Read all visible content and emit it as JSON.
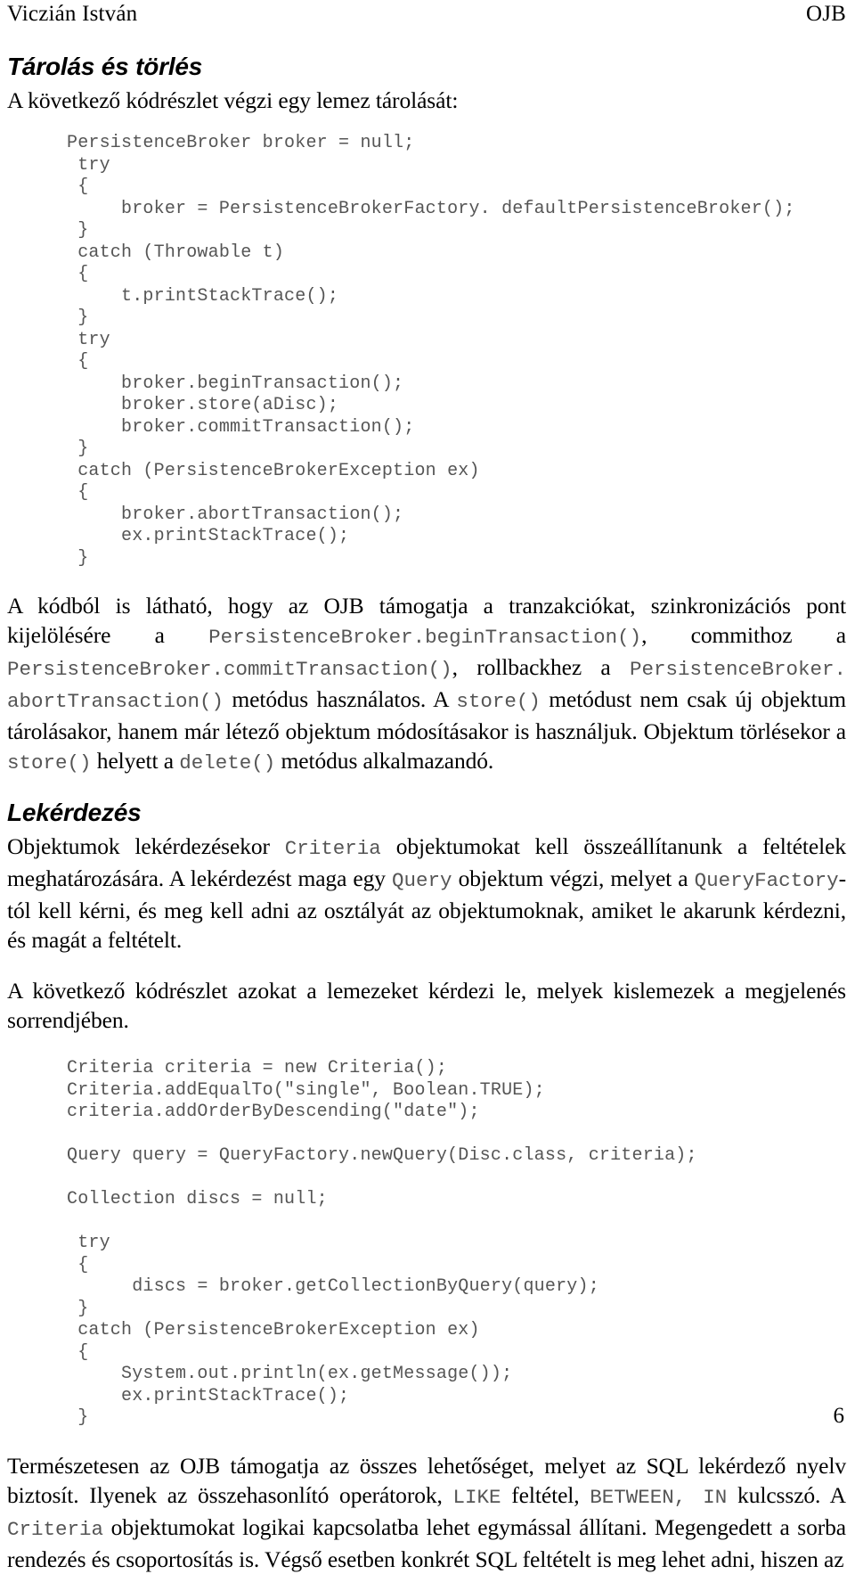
{
  "header": {
    "author": "Viczián István",
    "doc_title": "OJB"
  },
  "footer": {
    "page_number": "6"
  },
  "sections": [
    {
      "heading": "Tárolás és törlés",
      "intro": "A következő kódrészlet végzi egy lemez tárolását:",
      "code": "PersistenceBroker broker = null;\n try\n {\n     broker = PersistenceBrokerFactory. defaultPersistenceBroker();\n }\n catch (Throwable t)\n {\n     t.printStackTrace();\n }\n try\n {\n     broker.beginTransaction();\n     broker.store(aDisc);\n     broker.commitTransaction();\n }\n catch (PersistenceBrokerException ex)\n {\n     broker.abortTransaction();\n     ex.printStackTrace();\n }"
    },
    {
      "heading": "Lekérdezés"
    }
  ],
  "paragraphs": {
    "transactions": {
      "part1": "A kódból is látható, hogy az OJB támogatja a tranzakciókat, szinkronizációs pont kijelölésére a ",
      "code1": "PersistenceBroker.beginTransaction()",
      "part2": ", commithoz a ",
      "code2": "PersistenceBroker.commitTransaction()",
      "part3": ", rollbackhez a ",
      "code3": "PersistenceBroker. abortTransaction()",
      "part4": " metódus használatos. A ",
      "code4": "store()",
      "part5": " metódust nem csak új objektum tárolásakor, hanem már létező objektum módosításakor is használjuk. Objektum törlésekor a ",
      "code5": "store()",
      "part6": " helyett a ",
      "code6": "delete()",
      "part7": " metódus alkalmazandó."
    },
    "query_intro": {
      "part1": "Objektumok lekérdezésekor ",
      "code1": "Criteria",
      "part2": " objektumokat kell összeállítanunk a feltételek meghatározására. A lekérdezést maga egy ",
      "code2": "Query",
      "part3": " objektum végzi, melyet a ",
      "code3": "QueryFactory",
      "part4": "-tól kell kérni, és meg kell adni az osztályát az objektumoknak, amiket le akarunk kérdezni, és magát a feltételt."
    },
    "query_lead": {
      "text": "A következő kódrészlet azokat a lemezeket kérdezi le, melyek kislemezek a megjelenés sorrendjében."
    },
    "closing": {
      "part1": "Természetesen az OJB támogatja az összes lehetőséget, melyet az SQL lekérdező nyelv biztosít. Ilyenek az összehasonlító operátorok, ",
      "code1": "LIKE",
      "part2": " feltétel, ",
      "code2": "BETWEEN,  IN",
      "part3": " kulcsszó. A ",
      "code3": "Criteria",
      "part4": " objektumokat logikai kapcsolatba lehet egymással állítani. Megengedett a sorba rendezés és csoportosítás is. Végső esetben konkrét SQL feltételt is meg lehet adni, hiszen az"
    }
  },
  "code_blocks": {
    "query_example": "Criteria criteria = new Criteria();\nCriteria.addEqualTo(\"single\", Boolean.TRUE);\ncriteria.addOrderByDescending(\"date\");\n\nQuery query = QueryFactory.newQuery(Disc.class, criteria);\n\nCollection discs = null;\n\n try\n {\n      discs = broker.getCollectionByQuery(query);\n }\n catch (PersistenceBrokerException ex)\n {\n     System.out.println(ex.getMessage());\n     ex.printStackTrace();\n }"
  },
  "colors": {
    "text": "#000000",
    "code": "#555555",
    "background": "#ffffff"
  }
}
